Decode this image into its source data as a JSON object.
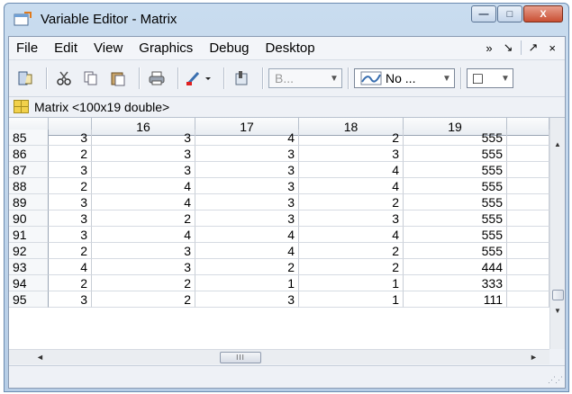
{
  "window": {
    "title": "Variable Editor - Matrix",
    "buttons": {
      "minimize": "—",
      "maximize": "□",
      "close": "X"
    }
  },
  "menubar": {
    "items": [
      "File",
      "Edit",
      "View",
      "Graphics",
      "Debug",
      "Desktop"
    ],
    "right": {
      "overflow": "»",
      "dock": "↘",
      "undock": "↗",
      "close": "×"
    }
  },
  "toolbar": {
    "icons": [
      "import-data-icon",
      "cut-icon",
      "copy-icon",
      "paste-icon",
      "print-icon",
      "brush-icon",
      "new-variable-icon"
    ],
    "combo_disabled": "B...",
    "plot_combo": "No ...",
    "plot_selection": "□"
  },
  "variable": {
    "label": "Matrix <100x19 double>"
  },
  "table": {
    "columns": [
      "",
      "",
      "16",
      "17",
      "18",
      "19",
      ""
    ],
    "rows": [
      {
        "id": "85",
        "values": [
          "3",
          "3",
          "4",
          "2",
          "555"
        ]
      },
      {
        "id": "86",
        "values": [
          "2",
          "3",
          "3",
          "3",
          "555"
        ]
      },
      {
        "id": "87",
        "values": [
          "3",
          "3",
          "3",
          "4",
          "555"
        ]
      },
      {
        "id": "88",
        "values": [
          "2",
          "4",
          "3",
          "4",
          "555"
        ]
      },
      {
        "id": "89",
        "values": [
          "3",
          "4",
          "3",
          "2",
          "555"
        ]
      },
      {
        "id": "90",
        "values": [
          "3",
          "2",
          "3",
          "3",
          "555"
        ]
      },
      {
        "id": "91",
        "values": [
          "3",
          "4",
          "4",
          "4",
          "555"
        ]
      },
      {
        "id": "92",
        "values": [
          "2",
          "3",
          "4",
          "2",
          "555"
        ]
      },
      {
        "id": "93",
        "values": [
          "4",
          "3",
          "2",
          "2",
          "444"
        ]
      },
      {
        "id": "94",
        "values": [
          "2",
          "2",
          "1",
          "1",
          "333"
        ]
      },
      {
        "id": "95",
        "values": [
          "3",
          "2",
          "3",
          "1",
          "111"
        ]
      }
    ]
  },
  "scroll": {
    "hthumb_grip": "III"
  },
  "colors": {
    "title_gradient_top": "#c9dcef",
    "close_button": "#c94f33",
    "grid_icon": "#f2d14b"
  }
}
